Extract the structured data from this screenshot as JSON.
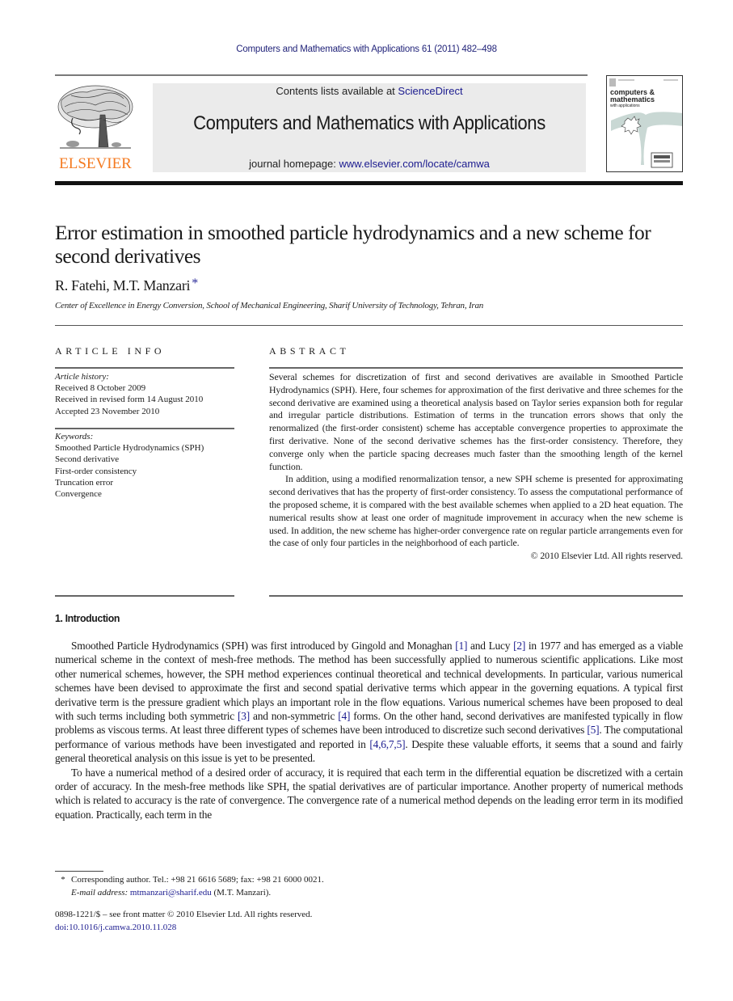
{
  "running_header": "Computers and Mathematics with Applications 61 (2011) 482–498",
  "masthead": {
    "publisher": "ELSEVIER",
    "contents_prefix": "Contents lists available at ",
    "contents_link": "ScienceDirect",
    "journal_title": "Computers and Mathematics with Applications",
    "homepage_prefix": "journal homepage: ",
    "homepage_link": "www.elsevier.com/locate/camwa",
    "cover": {
      "line1": "computers &",
      "line2": "mathematics",
      "line3": "with applications"
    }
  },
  "article": {
    "title": "Error estimation in smoothed particle hydrodynamics and a new scheme for second derivatives",
    "authors": "R. Fatehi, M.T. Manzari",
    "author_mark": "*",
    "affiliation": "Center of Excellence in Energy Conversion, School of Mechanical Engineering, Sharif University of Technology, Tehran, Iran"
  },
  "article_info": {
    "heading": "ARTICLE INFO",
    "history_label": "Article history:",
    "history": [
      "Received 8 October 2009",
      "Received in revised form 14 August 2010",
      "Accepted 23 November 2010"
    ],
    "keywords_label": "Keywords:",
    "keywords": [
      "Smoothed Particle Hydrodynamics (SPH)",
      "Second derivative",
      "First-order consistency",
      "Truncation error",
      "Convergence"
    ]
  },
  "abstract": {
    "heading": "ABSTRACT",
    "paragraphs": [
      "Several schemes for discretization of first and second derivatives are available in Smoothed Particle Hydrodynamics (SPH). Here, four schemes for approximation of the first derivative and three schemes for the second derivative are examined using a theoretical analysis based on Taylor series expansion both for regular and irregular particle distributions. Estimation of terms in the truncation errors shows that only the renormalized (the first-order consistent) scheme has acceptable convergence properties to approximate the first derivative. None of the second derivative schemes has the first-order consistency. Therefore, they converge only when the particle spacing decreases much faster than the smoothing length of the kernel function.",
      "In addition, using a modified renormalization tensor, a new SPH scheme is presented for approximating second derivatives that has the property of first-order consistency. To assess the computational performance of the proposed scheme, it is compared with the best available schemes when applied to a 2D heat equation. The numerical results show at least one order of magnitude improvement in accuracy when the new scheme is used. In addition, the new scheme has higher-order convergence rate on regular particle arrangements even for the case of only four particles in the neighborhood of each particle."
    ],
    "copyright": "© 2010 Elsevier Ltd. All rights reserved."
  },
  "introduction": {
    "heading": "1.  Introduction",
    "p1": [
      {
        "t": "Smoothed Particle Hydrodynamics (SPH) was first introduced by Gingold and Monaghan "
      },
      {
        "t": "[1]",
        "ref": true
      },
      {
        "t": " and Lucy "
      },
      {
        "t": "[2]",
        "ref": true
      },
      {
        "t": " in 1977 and has emerged as a viable numerical scheme in the context of mesh-free methods. The method has been successfully applied to numerous scientific applications. Like most other numerical schemes, however, the SPH method experiences continual theoretical and technical developments. In particular, various numerical schemes have been devised to approximate the first and second spatial derivative terms which appear in the governing equations. A typical first derivative term is the pressure gradient which plays an important role in the flow equations. Various numerical schemes have been proposed to deal with such terms including both symmetric "
      },
      {
        "t": "[3]",
        "ref": true
      },
      {
        "t": " and non-symmetric "
      },
      {
        "t": "[4]",
        "ref": true
      },
      {
        "t": " forms. On the other hand, second derivatives are manifested typically in flow problems as viscous terms. At least three different types of schemes have been introduced to discretize such second derivatives "
      },
      {
        "t": "[5]",
        "ref": true
      },
      {
        "t": ". The computational performance of various methods have been investigated and reported in "
      },
      {
        "t": "[4,6,7,5]",
        "ref": true
      },
      {
        "t": ". Despite these valuable efforts, it seems that a sound and fairly general theoretical analysis on this issue is yet to be presented."
      }
    ],
    "p2": "To have a numerical method of a desired order of accuracy, it is required that each term in the differential equation be discretized with a certain order of accuracy. In the mesh-free methods like SPH, the spatial derivatives are of particular importance. Another property of numerical methods which is related to accuracy is the rate of convergence. The convergence rate of a numerical method depends on the leading error term in its modified equation. Practically, each term in the"
  },
  "footnotes": {
    "star": "*",
    "corresponding": "Corresponding author. Tel.: +98 21 6616 5689; fax: +98 21 6000 0021.",
    "email_label": "E-mail address:",
    "email": "mtmanzari@sharif.edu",
    "email_suffix": " (M.T. Manzari).",
    "issn_line": "0898-1221/$ – see front matter © 2010 Elsevier Ltd. All rights reserved.",
    "doi": "doi:10.1016/j.camwa.2010.11.028"
  }
}
